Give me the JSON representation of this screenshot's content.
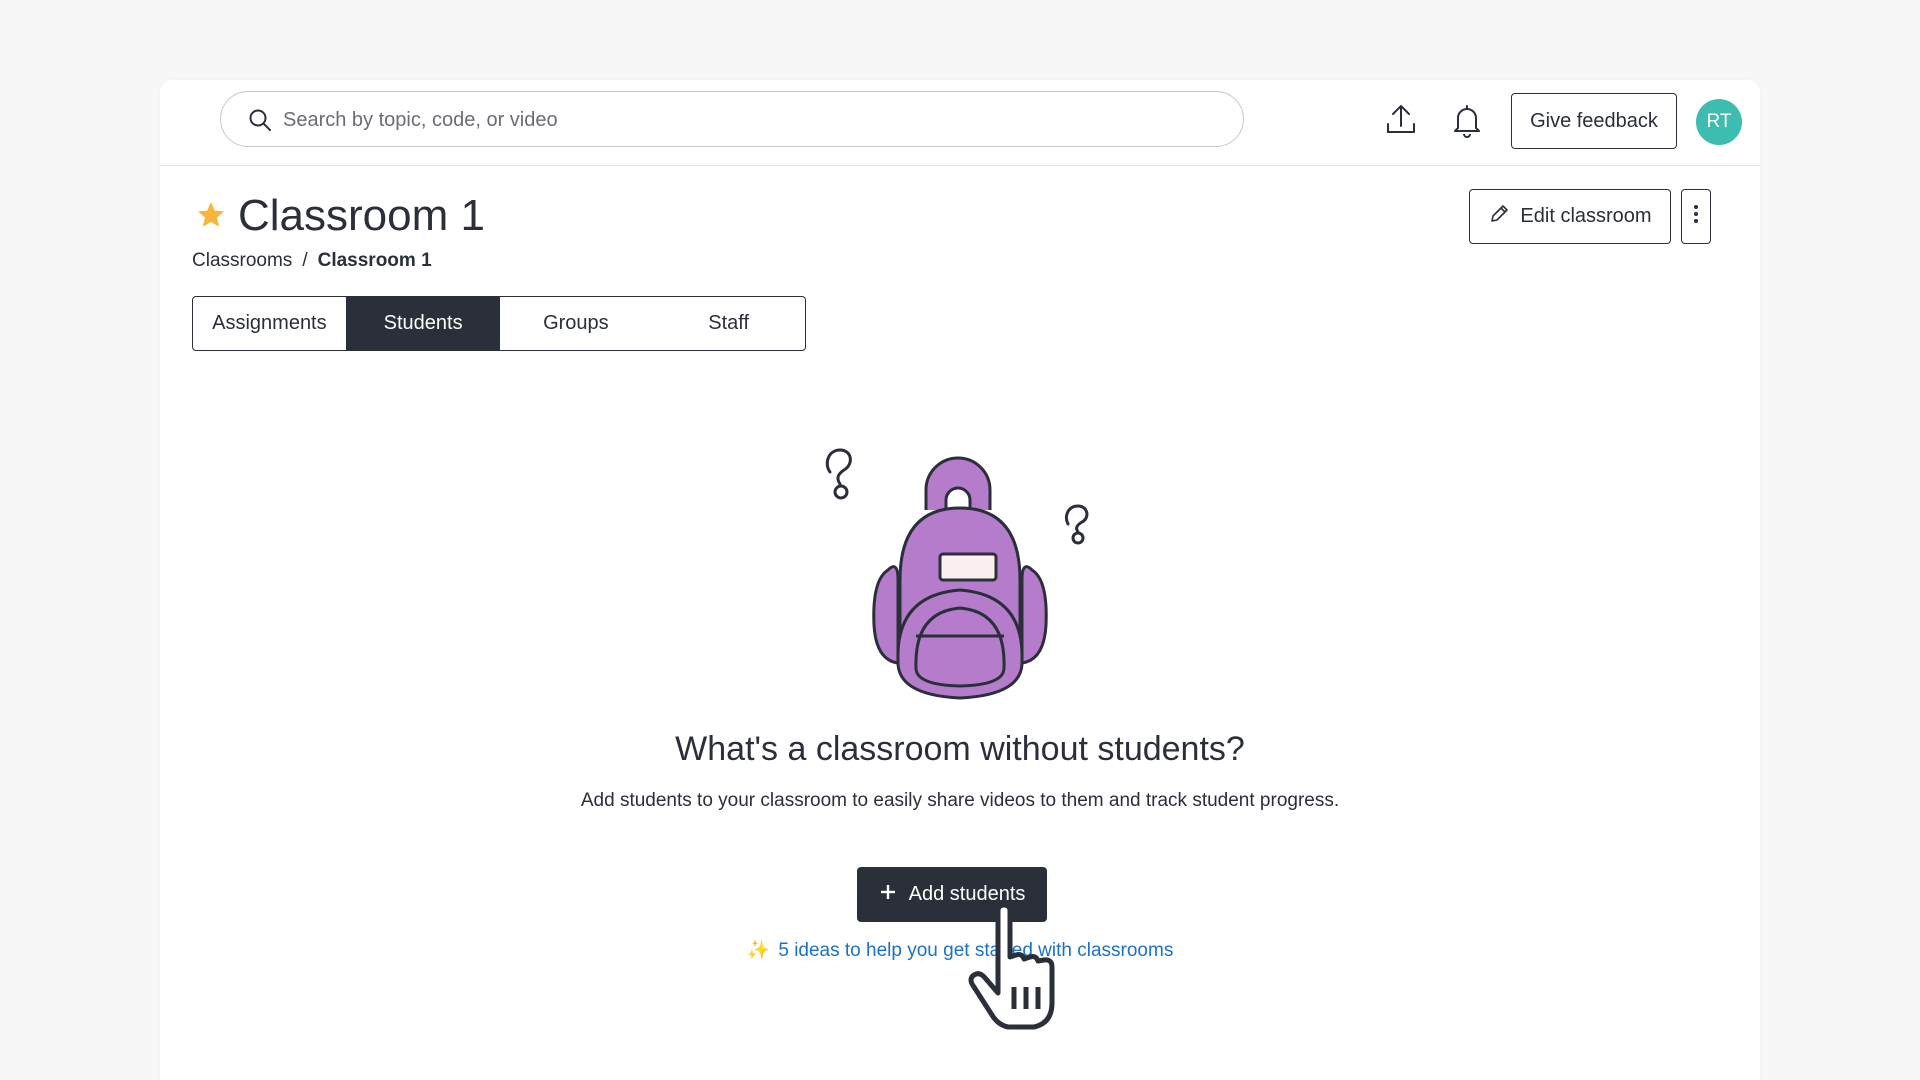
{
  "search": {
    "placeholder": "Search by topic, code, or video"
  },
  "header": {
    "feedback_label": "Give feedback",
    "avatar_initials": "RT",
    "avatar_color": "#3dbcb0",
    "upload_icon": "upload-icon",
    "bell_icon": "bell-icon"
  },
  "page": {
    "title": "Classroom 1",
    "favorite": true,
    "breadcrumb": {
      "root": "Classrooms",
      "separator": "/",
      "current": "Classroom 1"
    },
    "edit_label": "Edit classroom"
  },
  "tabs": [
    {
      "label": "Assignments",
      "active": false
    },
    {
      "label": "Students",
      "active": true
    },
    {
      "label": "Groups",
      "active": false
    },
    {
      "label": "Staff",
      "active": false
    }
  ],
  "empty_state": {
    "title": "What's a classroom without students?",
    "text": "Add students to your classroom to easily share videos to them and track student progress.",
    "add_label": "Add students",
    "ideas_link": "5 ideas to help you get started with classrooms"
  },
  "colors": {
    "primary_dark": "#2b2f3a",
    "link": "#1a72c4",
    "star": "#f4b73e",
    "backpack": "#b57ccc"
  }
}
